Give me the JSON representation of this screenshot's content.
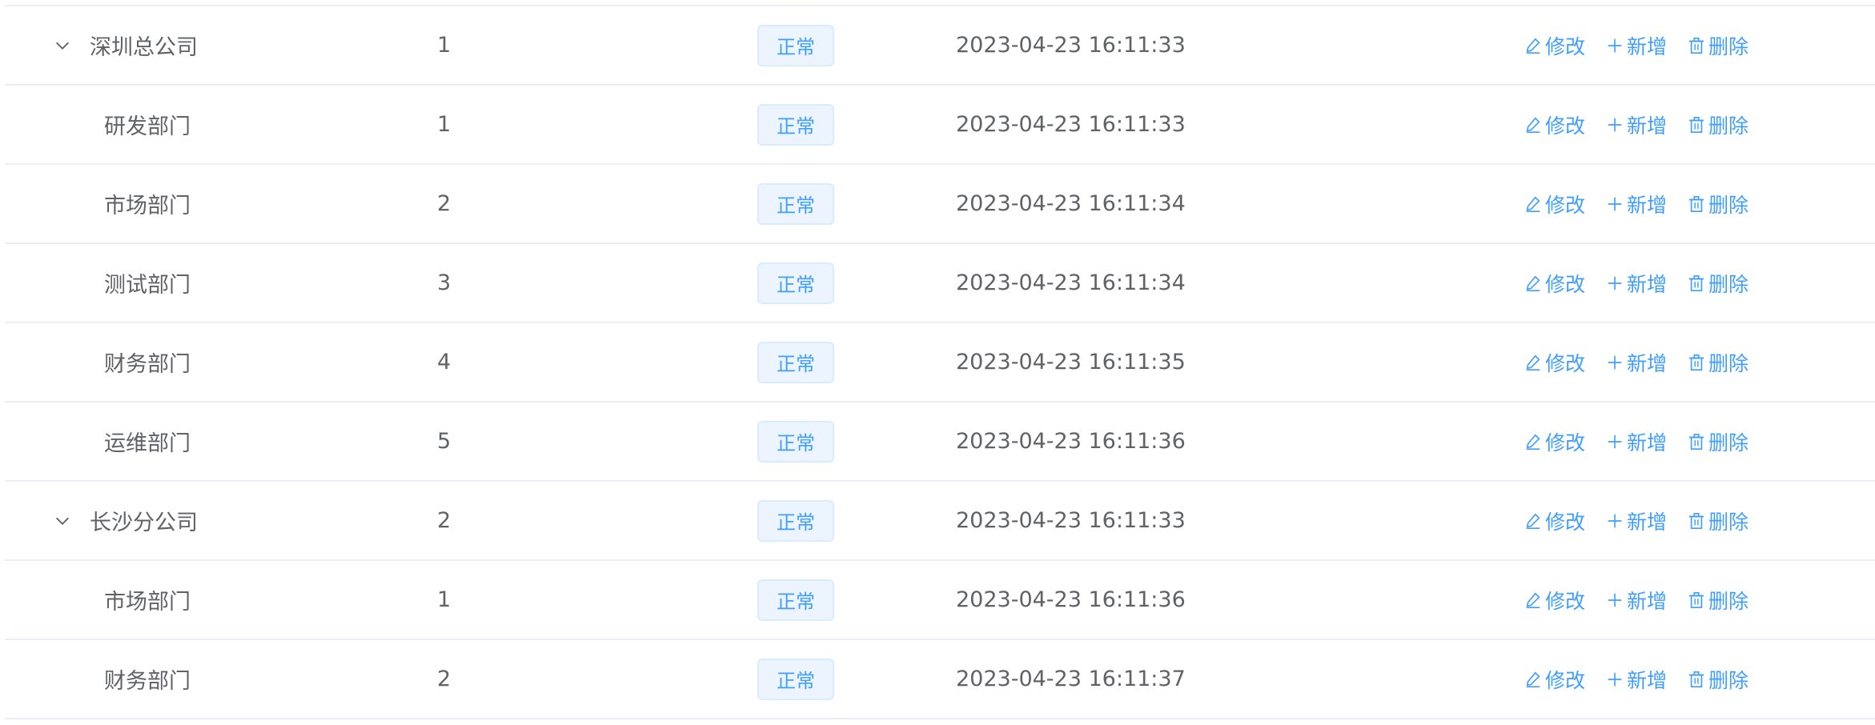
{
  "table": {
    "rows": [
      {
        "name": "深圳总公司",
        "order": "1",
        "status": "正常",
        "created": "2023-04-23 16:11:33",
        "expandable": true,
        "child": false
      },
      {
        "name": "研发部门",
        "order": "1",
        "status": "正常",
        "created": "2023-04-23 16:11:33",
        "expandable": false,
        "child": true
      },
      {
        "name": "市场部门",
        "order": "2",
        "status": "正常",
        "created": "2023-04-23 16:11:34",
        "expandable": false,
        "child": true
      },
      {
        "name": "测试部门",
        "order": "3",
        "status": "正常",
        "created": "2023-04-23 16:11:34",
        "expandable": false,
        "child": true
      },
      {
        "name": "财务部门",
        "order": "4",
        "status": "正常",
        "created": "2023-04-23 16:11:35",
        "expandable": false,
        "child": true
      },
      {
        "name": "运维部门",
        "order": "5",
        "status": "正常",
        "created": "2023-04-23 16:11:36",
        "expandable": false,
        "child": true
      },
      {
        "name": "长沙分公司",
        "order": "2",
        "status": "正常",
        "created": "2023-04-23 16:11:33",
        "expandable": true,
        "child": false
      },
      {
        "name": "市场部门",
        "order": "1",
        "status": "正常",
        "created": "2023-04-23 16:11:36",
        "expandable": false,
        "child": true
      },
      {
        "name": "财务部门",
        "order": "2",
        "status": "正常",
        "created": "2023-04-23 16:11:37",
        "expandable": false,
        "child": true
      }
    ],
    "actions": {
      "edit_label": "修改",
      "add_label": "新增",
      "delete_label": "删除"
    }
  },
  "icons": {
    "expand": "chevron-down-icon",
    "edit": "edit-icon",
    "add": "plus-icon",
    "delete": "delete-icon"
  },
  "colors": {
    "link": "#409eff",
    "tag_bg": "#ecf5ff",
    "tag_border": "#d9ecff",
    "text": "#606266",
    "border": "#ebeef5"
  }
}
